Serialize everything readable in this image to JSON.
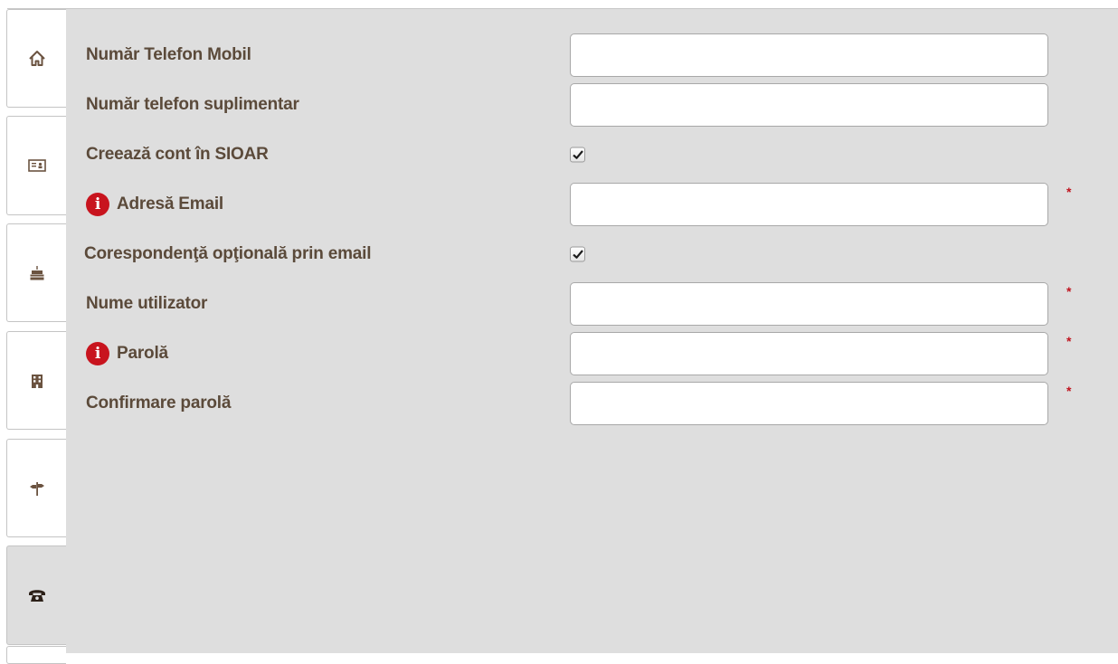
{
  "sidebar": {
    "tabs": [
      {
        "icon": "home-icon"
      },
      {
        "icon": "id-card-icon"
      },
      {
        "icon": "birthday-cake-icon"
      },
      {
        "icon": "building-icon"
      },
      {
        "icon": "signpost-icon"
      },
      {
        "icon": "phone-icon",
        "active": true
      }
    ]
  },
  "form": {
    "mobile_phone": {
      "label": "Număr Telefon Mobil",
      "value": ""
    },
    "extra_phone": {
      "label": "Număr telefon suplimentar",
      "value": ""
    },
    "create_account": {
      "label": "Creează cont în SIOAR",
      "checked": true
    },
    "email": {
      "label": "Adresă Email",
      "value": "",
      "required_mark": "*"
    },
    "optional_email": {
      "label": "Corespondenţă opţională prin email",
      "checked": true
    },
    "username": {
      "label": "Nume utilizator",
      "value": "",
      "required_mark": "*"
    },
    "password": {
      "label": "Parolă",
      "value": "",
      "required_mark": "*"
    },
    "confirm_password": {
      "label": "Confirmare parolă",
      "value": "",
      "required_mark": "*"
    }
  },
  "colors": {
    "panel_bg": "#dedede",
    "label_text": "#5b4a3a",
    "info_icon": "#c8141e",
    "required_mark": "#c0141e",
    "icon_color": "#6b5340"
  }
}
